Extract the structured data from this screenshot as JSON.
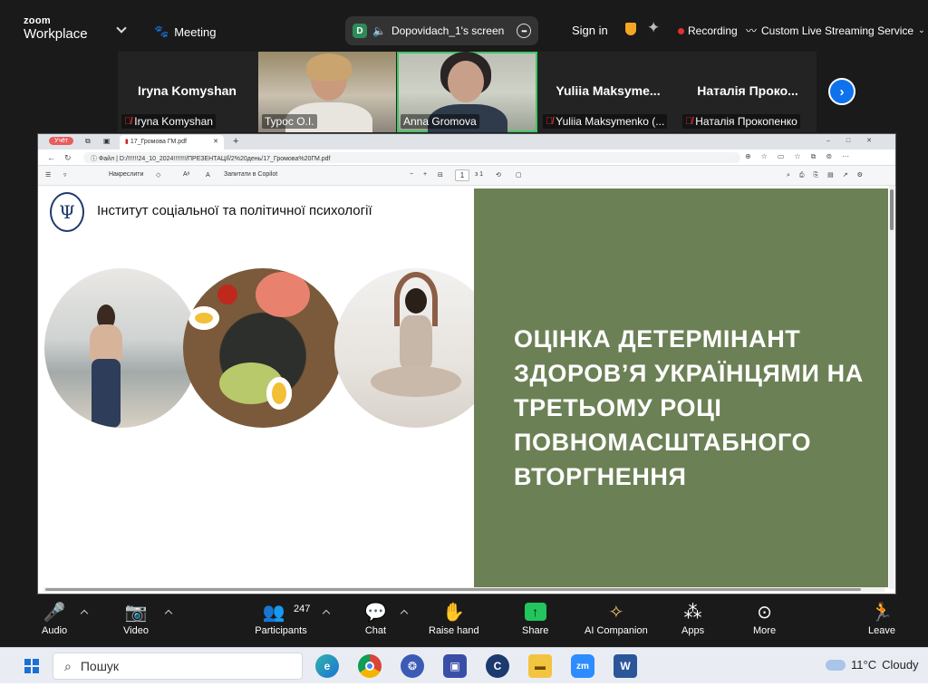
{
  "topbar": {
    "brand_line1": "zoom",
    "brand_line2": "Workplace",
    "meeting_label": "Meeting",
    "share_avatar": "D",
    "share_title": "Dopovidach_1's screen",
    "signin": "Sign in",
    "recording": "Recording",
    "streaming": "Custom Live Streaming Service"
  },
  "participants": [
    {
      "name": "Iryna Komyshan",
      "label": "Iryna Komyshan",
      "muted": true,
      "video": false
    },
    {
      "name": "",
      "label": "Турос О.І.",
      "muted": false,
      "video": true
    },
    {
      "name": "",
      "label": "Anna Gromova",
      "muted": false,
      "video": true,
      "active": true
    },
    {
      "name": "Yuliia  Maksyme...",
      "label": "Yuliia Maksymenko (...",
      "muted": true,
      "video": false
    },
    {
      "name": "Наталія  Проко...",
      "label": "Наталія Прокопенко",
      "muted": true,
      "video": false
    }
  ],
  "browser": {
    "profile": "Учёт",
    "tab_title": "17_Громова ГМ.pdf",
    "url_prefix": "Файл",
    "url": "D:/!!!!!!24_10_2024!!!!!!!/ПРЕЗЕНТАЦІЇ/2%20день/17_Громова%20ГМ.pdf",
    "draw_label": "Накреслити",
    "page_number": "1",
    "page_total": "з 1",
    "copilot": "Запитати в Copilot"
  },
  "slide": {
    "logo_symbol": "Ψ",
    "institute": "Інститут соціальної та політичної психології",
    "title_lines": [
      "ОЦІНКА ДЕТЕРМІНАНТ",
      "ЗДОРОВ’Я УКРАЇНЦЯМИ НА",
      "ТРЕТЬОМУ РОЦІ",
      "ПОВНОМАСШТАБНОГО",
      "ВТОРГНЕННЯ"
    ],
    "panel_color": "#6c8055"
  },
  "toolbar": {
    "audio": "Audio",
    "video": "Video",
    "participants": "Participants",
    "participants_count": "247",
    "chat": "Chat",
    "raise_hand": "Raise hand",
    "share": "Share",
    "ai_companion": "AI Companion",
    "apps": "Apps",
    "more": "More",
    "leave": "Leave"
  },
  "taskbar": {
    "search_placeholder": "Пошук",
    "temperature": "11°C",
    "weather": "Cloudy"
  }
}
